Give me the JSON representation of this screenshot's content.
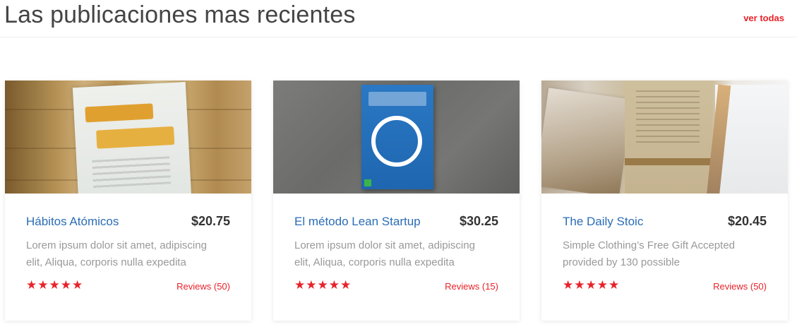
{
  "section": {
    "title": "Las publicaciones mas recientes",
    "see_more": "ver todas"
  },
  "colors": {
    "accent": "#e8222a",
    "link": "#2a6db5",
    "muted": "#999999"
  },
  "cards": [
    {
      "title": "Hábitos Atómicos",
      "price": "$20.75",
      "desc_line1": "Lorem ipsum dolor sit amet, adipiscing",
      "desc_line2": "elit, Aliqua, corporis nulla expedita",
      "stars": "★★★★★",
      "rating": 5,
      "reviews": "Reviews (50)",
      "image": "book-on-wood"
    },
    {
      "title": "El método Lean Startup",
      "price": "$30.25",
      "desc_line1": "Lorem ipsum dolor sit amet, adipiscing",
      "desc_line2": "elit, Aliqua, corporis nulla expedita",
      "stars": "★★★★★",
      "rating": 5,
      "reviews": "Reviews (15)",
      "image": "blue-book-on-grey"
    },
    {
      "title": "The Daily Stoic",
      "price": "$20.45",
      "desc_line1": "Simple Clothing’s Free Gift Accepted",
      "desc_line2": "provided by 130 possible",
      "stars": "★★★★★",
      "rating": 5,
      "reviews": "Reviews (50)",
      "image": "papers-and-documents"
    }
  ]
}
